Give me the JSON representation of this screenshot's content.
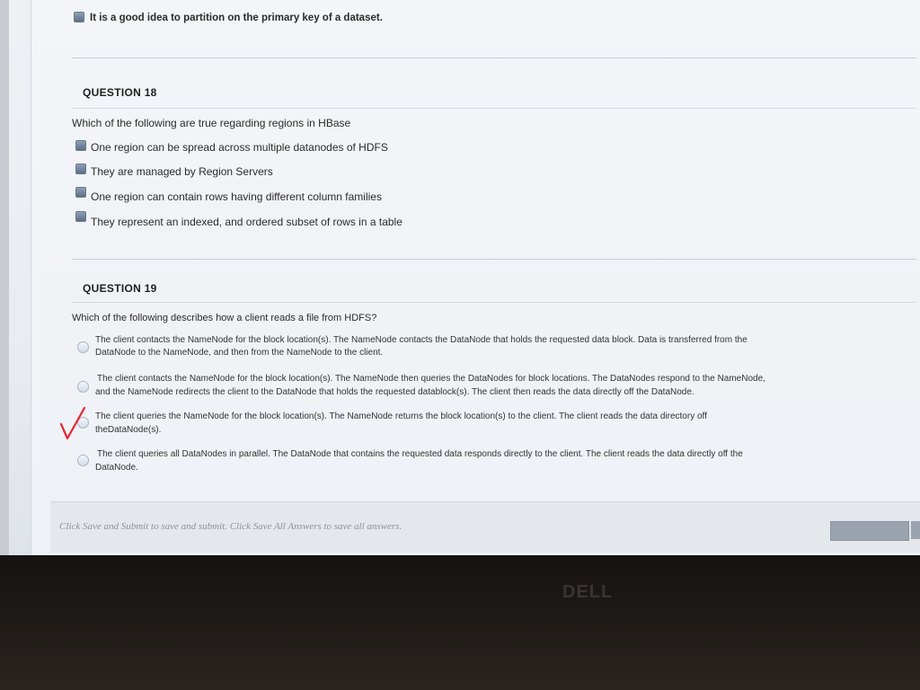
{
  "prev_question": {
    "option_text": "It is a good idea to partition on the primary key of a dataset."
  },
  "question18": {
    "heading": "QUESTION 18",
    "prompt": "Which of the following are true regarding regions in HBase",
    "options": [
      "One region can be spread across multiple datanodes of HDFS",
      "They are managed by Region Servers",
      "One region can contain rows having different column families",
      "They represent an indexed, and ordered subset of rows in a table"
    ]
  },
  "question19": {
    "heading": "QUESTION 19",
    "prompt": "Which of the following describes how a client reads a file from HDFS?",
    "options": [
      {
        "line1": "The client contacts the NameNode for the block location(s). The NameNode contacts the DataNode that holds the requested data block. Data is transferred from the",
        "line2": "DataNode to the NameNode, and then from the NameNode to the client."
      },
      {
        "line1": "The client contacts the NameNode for the block location(s). The NameNode then queries the DataNodes for block locations. The DataNodes respond to the NameNode,",
        "line2": "and the NameNode redirects the client to the DataNode that holds the requested datablock(s). The client then reads the data directly off the DataNode."
      },
      {
        "line1": "The client queries the NameNode for the block location(s). The NameNode returns the block location(s) to the client. The client reads the data directory off",
        "line2": "theDataNode(s)."
      },
      {
        "line1": "The client queries all DataNodes in parallel. The DataNode that contains the requested data responds directly to the client. The client reads the data directly off the",
        "line2": "DataNode."
      }
    ]
  },
  "footer": {
    "instructions": "Click Save and Submit to save and submit. Click Save All Answers to save all answers."
  },
  "bezel": {
    "brand": "DELL"
  },
  "colors": {
    "checkmark": "#e8262e",
    "checkbox": "#6c7f98"
  }
}
